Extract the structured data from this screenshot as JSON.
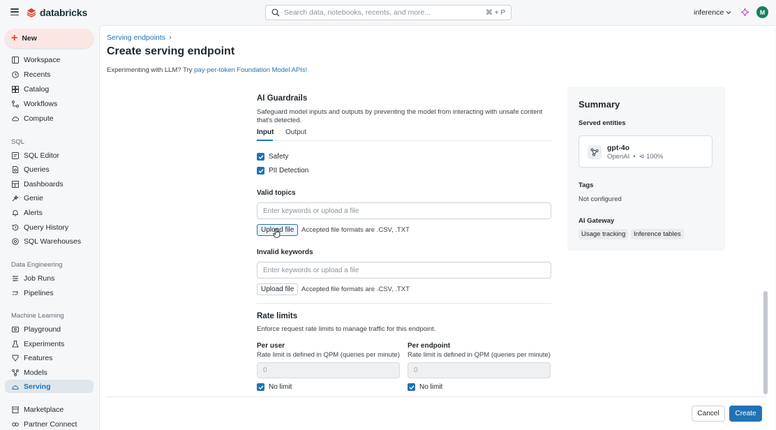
{
  "app": {
    "logo_text": "databricks",
    "brand_color": "#e0452a",
    "accent_color": "#2272b4"
  },
  "search": {
    "placeholder": "Search data, notebooks, recents, and more...",
    "shortcut": "⌘ + P"
  },
  "header": {
    "workspace": "inference",
    "avatar_initial": "M"
  },
  "sidebar": {
    "new_label": "New",
    "items": [
      {
        "label": "Workspace",
        "icon": "workspace-icon"
      },
      {
        "label": "Recents",
        "icon": "clock-icon"
      },
      {
        "label": "Catalog",
        "icon": "catalog-icon"
      },
      {
        "label": "Workflows",
        "icon": "workflows-icon"
      },
      {
        "label": "Compute",
        "icon": "cloud-icon"
      }
    ],
    "sql_section": "SQL",
    "sql_items": [
      {
        "label": "SQL Editor",
        "icon": "editor-icon"
      },
      {
        "label": "Queries",
        "icon": "queries-icon"
      },
      {
        "label": "Dashboards",
        "icon": "dashboard-icon"
      },
      {
        "label": "Genie",
        "icon": "genie-icon"
      },
      {
        "label": "Alerts",
        "icon": "bell-icon"
      },
      {
        "label": "Query History",
        "icon": "history-icon"
      },
      {
        "label": "SQL Warehouses",
        "icon": "warehouse-icon"
      }
    ],
    "de_section": "Data Engineering",
    "de_items": [
      {
        "label": "Job Runs",
        "icon": "job-runs-icon"
      },
      {
        "label": "Pipelines",
        "icon": "pipelines-icon"
      }
    ],
    "ml_section": "Machine Learning",
    "ml_items": [
      {
        "label": "Playground",
        "icon": "playground-icon"
      },
      {
        "label": "Experiments",
        "icon": "experiments-icon"
      },
      {
        "label": "Features",
        "icon": "features-icon"
      },
      {
        "label": "Models",
        "icon": "models-icon"
      },
      {
        "label": "Serving",
        "icon": "serving-icon",
        "active": true
      }
    ],
    "bottom_items": [
      {
        "label": "Marketplace",
        "icon": "marketplace-icon"
      },
      {
        "label": "Partner Connect",
        "icon": "partner-icon"
      }
    ]
  },
  "page": {
    "breadcrumb": "Serving endpoints",
    "title": "Create serving endpoint",
    "hint_prefix": "Experimenting with LLM? Try ",
    "hint_link": "pay-per-token Foundation Model APIs!"
  },
  "guardrails": {
    "title": "AI Guardrails",
    "description": "Safeguard model inputs and outputs by preventing the model from interacting with unsafe content that's detected.",
    "tabs": [
      "Input",
      "Output"
    ],
    "safety_label": "Safety",
    "pii_label": "PII Detection",
    "valid_topics_label": "Valid topics",
    "valid_topics_placeholder": "Enter keywords or upload a file",
    "invalid_keywords_label": "Invalid keywords",
    "invalid_keywords_placeholder": "Enter keywords or upload a file",
    "upload_label": "Upload file",
    "upload_note": "Accepted file formats are .CSV, .TXT"
  },
  "rate_limits": {
    "title": "Rate limits",
    "description": "Enforce request rate limits to manage traffic for this endpoint.",
    "per_user_label": "Per user",
    "per_user_desc": "Rate limit is defined in QPM (queries per minute)",
    "per_user_value": "0",
    "per_endpoint_label": "Per endpoint",
    "per_endpoint_desc": "Rate limit is defined in QPM (queries per minute)",
    "per_endpoint_value": "0",
    "no_limit_label": "No limit"
  },
  "summary": {
    "title": "Summary",
    "served_entities_label": "Served entities",
    "entity_name": "gpt-4o",
    "entity_provider": "OpenAI",
    "entity_separator": "•",
    "entity_traffic": "⊲ 100%",
    "tags_label": "Tags",
    "tags_value": "Not configured",
    "gateway_label": "AI Gateway",
    "gateway_chips": [
      "Usage tracking",
      "Inference tables"
    ]
  },
  "footer": {
    "cancel_label": "Cancel",
    "create_label": "Create"
  }
}
